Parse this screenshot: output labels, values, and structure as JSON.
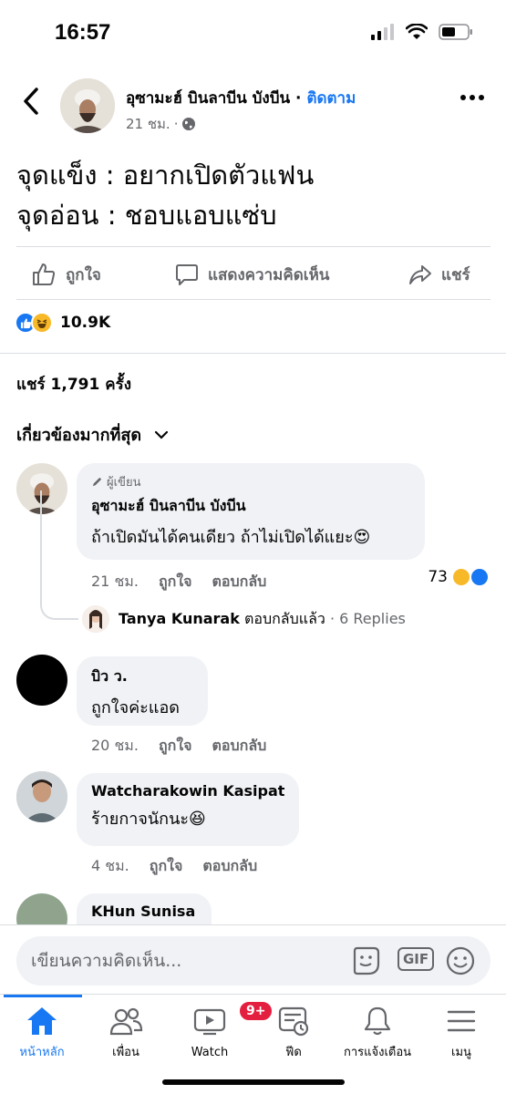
{
  "status_bar": {
    "time": "16:57"
  },
  "post": {
    "author": "อุซามะฮ์ บินลาบีน บังบีน",
    "separator": " · ",
    "follow_label": "ติดตาม",
    "time": "21 ชม.",
    "dot": "·",
    "lines": [
      "จุดแข็ง : อยากเปิดตัวแฟน",
      "จุดอ่อน : ชอบแอบแซ่บ"
    ],
    "like_label": "ถูกใจ",
    "comment_label": "แสดงความคิดเห็น",
    "share_label": "แชร์",
    "reaction_count": "10.9K",
    "share_count": "แชร์ 1,791 ครั้ง",
    "sort_label": "เกี่ยวข้องมากที่สุด"
  },
  "comments": [
    {
      "badge": "ผู้เขียน",
      "name": "อุซามะฮ์ บินลาบีน บังบีน",
      "text": "ถ้าเปิดมันได้คนเดียว ถ้าไม่เปิดได้แยะ😍",
      "time": "21 ชม.",
      "like": "ถูกใจ",
      "reply": "ตอบกลับ",
      "reaction_count": "73",
      "reply_summary": {
        "name": "Tanya Kunarak",
        "action": "ตอบกลับแล้ว",
        "dot": "·",
        "replies": "6 Replies"
      }
    },
    {
      "name": "บิว ว.",
      "text": "ถูกใจค่ะแอด",
      "time": "20 ชม.",
      "like": "ถูกใจ",
      "reply": "ตอบกลับ"
    },
    {
      "name": "Watcharakowin Kasipat",
      "text": "ร้ายกาจนักนะ😆",
      "time": "4 ชม.",
      "like": "ถูกใจ",
      "reply": "ตอบกลับ"
    },
    {
      "name": "KHun Sunisa"
    }
  ],
  "composer": {
    "placeholder": "เขียนความคิดเห็น...",
    "gif": "GIF"
  },
  "tabs": [
    {
      "label": "หน้าหลัก",
      "icon": "home-icon",
      "active": true
    },
    {
      "label": "เพื่อน",
      "icon": "friends-icon"
    },
    {
      "label": "Watch",
      "icon": "watch-icon",
      "badge": "9+"
    },
    {
      "label": "ฟีด",
      "icon": "feeds-icon"
    },
    {
      "label": "การแจ้งเตือน",
      "icon": "bell-icon"
    },
    {
      "label": "เมนู",
      "icon": "menu-icon"
    }
  ],
  "colors": {
    "accent": "#1877f2",
    "badge": "#e41e3f",
    "bubble": "#f0f2f5",
    "muted": "#65676b"
  }
}
